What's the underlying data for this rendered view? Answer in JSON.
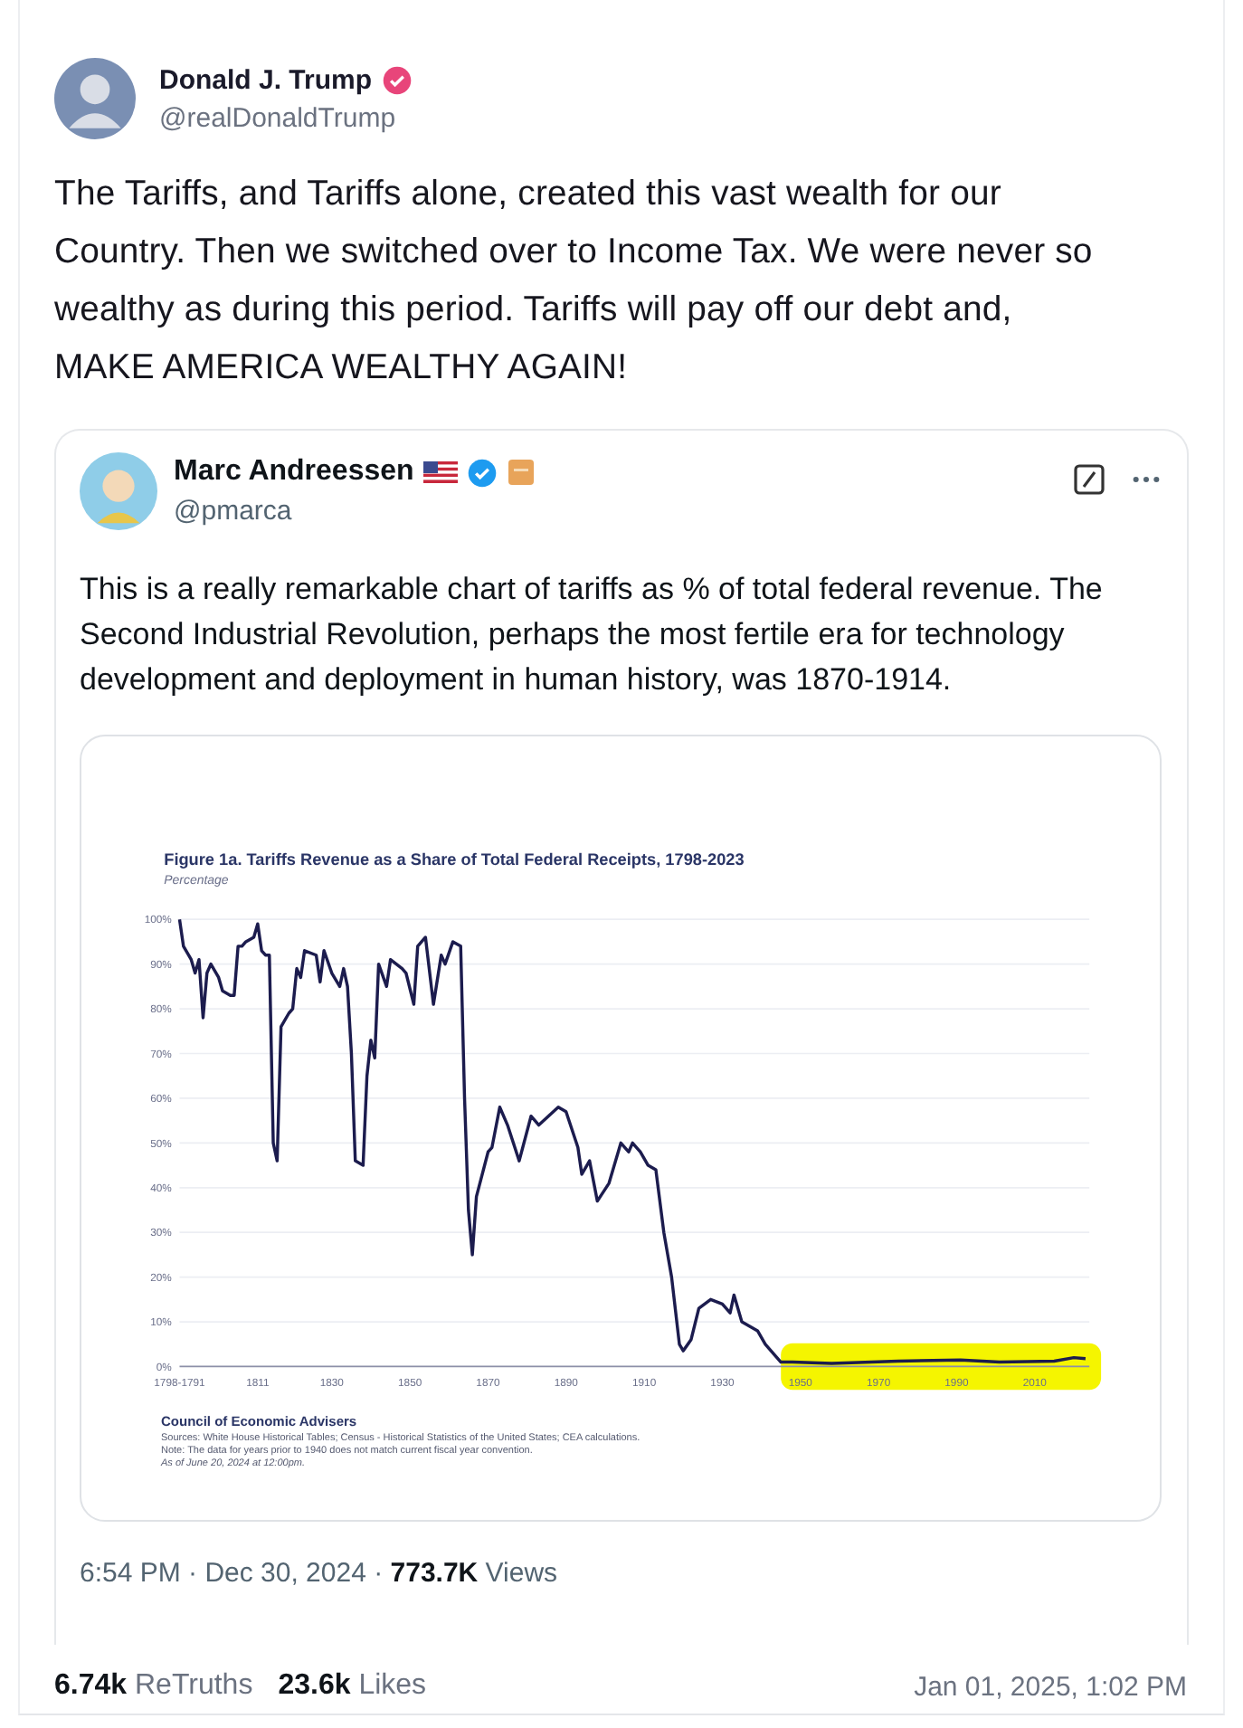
{
  "post": {
    "author": "Donald J. Trump",
    "verified": true,
    "handle": "@realDonaldTrump",
    "text": "The Tariffs, and Tariffs alone, created this vast wealth for our Country. Then we switched over to Income Tax. We were never so wealthy as during this period. Tariffs will pay off our debt and, MAKE AMERICA WEALTHY AGAIN!"
  },
  "quote": {
    "author": "Marc Andreessen",
    "verified": true,
    "handle": "@pmarca",
    "text": "This is a really remarkable chart of tariffs as % of total federal revenue. The Second Industrial Revolution, perhaps the most fertile era for technology development and deployment in human history, was 1870-1914.",
    "image": {
      "chart_data": {
        "type": "line",
        "title": "Figure 1a. Tariffs Revenue as a Share of Total Federal Receipts, 1798-2023",
        "ylabel": "Percentage",
        "xlim": [
          1791,
          2024
        ],
        "ylim": [
          0,
          100
        ],
        "x": [
          1791,
          1792,
          1794,
          1795,
          1796,
          1797,
          1798,
          1799,
          1801,
          1802,
          1804,
          1805,
          1806,
          1807,
          1808,
          1810,
          1811,
          1812,
          1813,
          1814,
          1815,
          1816,
          1817,
          1819,
          1820,
          1821,
          1822,
          1823,
          1826,
          1827,
          1828,
          1830,
          1832,
          1833,
          1834,
          1835,
          1836,
          1838,
          1839,
          1840,
          1841,
          1842,
          1844,
          1845,
          1848,
          1849,
          1851,
          1852,
          1854,
          1856,
          1858,
          1859,
          1861,
          1863,
          1864,
          1865,
          1866,
          1867,
          1870,
          1871,
          1873,
          1875,
          1878,
          1881,
          1883,
          1888,
          1890,
          1893,
          1894,
          1896,
          1898,
          1901,
          1904,
          1906,
          1907,
          1909,
          1911,
          1913,
          1915,
          1917,
          1919,
          1920,
          1922,
          1924,
          1927,
          1930,
          1932,
          1933,
          1935,
          1939,
          1941,
          1945,
          1948,
          1958,
          1975,
          1991,
          2001,
          2015,
          2020,
          2023
        ],
        "series": [
          {
            "color": "#1c1c4e",
            "values": [
              100,
              94,
              91,
              88,
              91,
              78,
              88,
              90,
              87,
              84,
              83,
              83,
              94,
              94,
              95,
              96,
              99,
              93,
              92,
              92,
              50,
              46,
              76,
              79,
              80,
              89,
              87,
              93,
              92,
              86,
              93,
              88,
              85,
              89,
              85,
              70,
              46,
              45,
              65,
              73,
              69,
              90,
              85,
              91,
              89,
              88,
              81,
              94,
              96,
              81,
              92,
              90,
              95,
              94,
              60,
              35,
              25,
              38,
              48,
              49,
              58,
              54,
              46,
              56,
              54,
              58,
              57,
              49,
              43,
              46,
              37,
              41,
              50,
              48,
              50,
              48,
              45,
              44,
              30,
              20,
              5,
              3.5,
              6,
              13,
              15,
              14,
              12,
              16,
              10,
              8,
              5,
              1,
              1,
              0.7,
              1.2,
              1.5,
              1,
              1.2,
              2,
              1.8
            ]
          }
        ],
        "grid": true,
        "xticks": [
          {
            "value": 1791,
            "label": "1798-1791"
          },
          1811,
          1830,
          1850,
          1870,
          1890,
          1910,
          1930,
          1950,
          1970,
          1990,
          2010
        ],
        "yticks": [
          {
            "value": 0,
            "label": "0%"
          },
          {
            "value": 10,
            "label": "10%"
          },
          {
            "value": 20,
            "label": "20%"
          },
          {
            "value": 30,
            "label": "30%"
          },
          {
            "value": 40,
            "label": "40%"
          },
          {
            "value": 50,
            "label": "50%"
          },
          {
            "value": 60,
            "label": "60%"
          },
          {
            "value": 70,
            "label": "70%"
          },
          {
            "value": 80,
            "label": "80%"
          },
          {
            "value": 90,
            "label": "90%"
          },
          {
            "value": 100,
            "label": "100%"
          }
        ]
      },
      "source": "Council of Economic Advisers",
      "notes": [
        "Sources: White House Historical Tables; Census - Historical Statistics of the United States; CEA calculations.",
        "Note: The data for years prior to 1940 does not match current fiscal year convention.",
        "As of June 20, 2024 at 12:00pm."
      ]
    },
    "meta": "6:54 PM · Dec 30, 2024 · **773.7K** Views"
  },
  "stats": [
    {
      "count": "6.74k",
      "label": "ReTruths"
    },
    {
      "count": "23.6k",
      "label": "Likes"
    }
  ],
  "date": "Jan 01, 2025, 1:02 PM"
}
